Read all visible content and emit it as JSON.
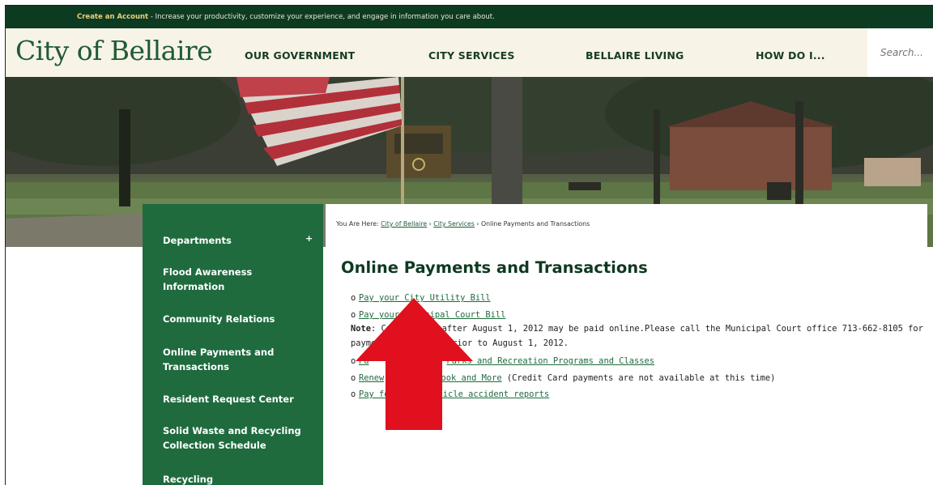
{
  "top_strip": {
    "link": "Create an Account",
    "text": " - Increase your productivity, customize your experience, and engage in information you care about."
  },
  "header": {
    "logo": "City of Bellaire",
    "nav": [
      "OUR GOVERNMENT",
      "CITY SERVICES",
      "BELLAIRE LIVING",
      "HOW DO I..."
    ],
    "search_placeholder": "Search..."
  },
  "sidebar": {
    "items": [
      "Departments",
      "Flood Awareness Information",
      "Community Relations",
      "Online Payments and Transactions",
      "Resident Request Center",
      "Solid Waste and Recycling Collection Schedule",
      "Recycling"
    ],
    "expand_symbol": "+"
  },
  "breadcrumb": {
    "prefix": "You Are Here: ",
    "crumbs": [
      "City of Bellaire",
      "City Services"
    ],
    "separator": "›",
    "current": "Online Payments and Transactions"
  },
  "main": {
    "title": "Online Payments and Transactions",
    "items": [
      {
        "link": "Pay your City Utility Bill"
      },
      {
        "link": "Pay your Municipal Court Bill"
      }
    ],
    "note_label": "Note",
    "note_line1": ": Ca       ed on or after August 1, 2012 may be paid online.Please call the Municipal Court office 713-662-8105 for",
    "note_line2": "payme      tions issued prior to August 1, 2012.",
    "item3_link_a": "Pa",
    "item3_link_b": "Parks and Recreation Programs and Classes",
    "item4_link_a": "Renew",
    "item4_link_b": "Book and More",
    "item4_text": " (Credit Card payments are not available at this time)",
    "item5_link_a": "Pay fo",
    "item5_link_b": "hicle accident reports",
    "bullet": "o"
  },
  "colors": {
    "brand_green": "#1f6b3e",
    "dark_green": "#0d3b22",
    "cream": "#f7f3e6",
    "arrow_red": "#e0101e"
  }
}
